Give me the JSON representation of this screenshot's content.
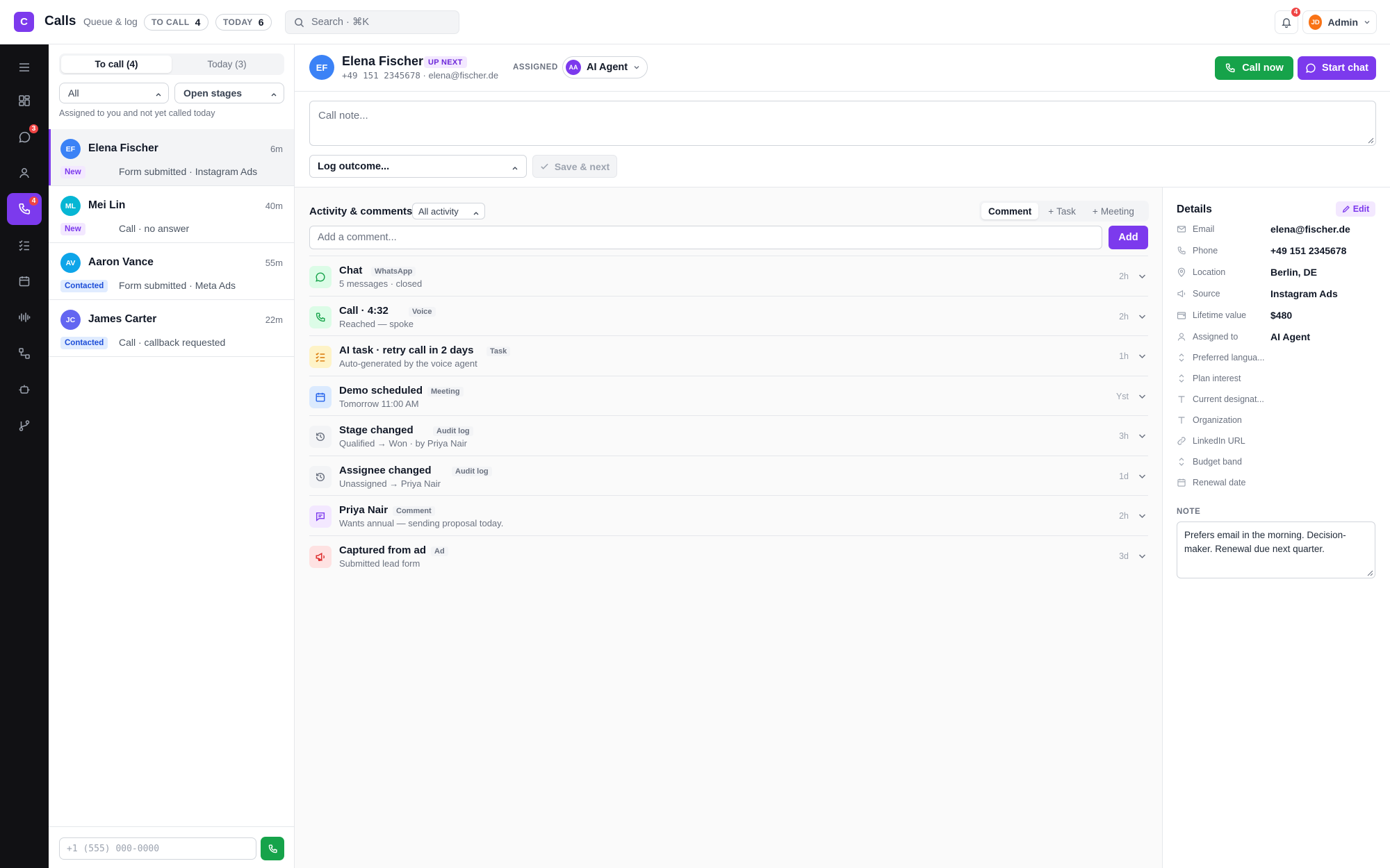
{
  "app": {
    "logo_letter": "C",
    "title": "Calls",
    "subtitle": "Queue & log"
  },
  "header": {
    "to_call_label": "TO CALL",
    "to_call_count": "4",
    "today_label": "TODAY",
    "today_count": "6",
    "search_placeholder": "Search · ⌘K",
    "notifications_count": "4",
    "user_initials": "JD",
    "user_name": "Admin"
  },
  "rail": {
    "messages_badge": "3",
    "calls_badge": "4"
  },
  "queue": {
    "tabs": [
      "To call (4)",
      "Today (3)"
    ],
    "filter_1": "All",
    "filter_2": "Open stages",
    "hint": "Assigned to you and not yet called today",
    "items": [
      {
        "initials": "EF",
        "name": "Elena Fischer",
        "time": "6m",
        "tag": "New",
        "desc": "Form submitted · Instagram Ads",
        "color": "#3b82f6"
      },
      {
        "initials": "ML",
        "name": "Mei Lin",
        "time": "40m",
        "tag": "New",
        "desc": "Call · no answer",
        "color": "#06b6d4"
      },
      {
        "initials": "AV",
        "name": "Aaron Vance",
        "time": "55m",
        "tag": "Contacted",
        "desc": "Form submitted · Meta Ads",
        "color": "#0ea5e9"
      },
      {
        "initials": "JC",
        "name": "James Carter",
        "time": "22m",
        "tag": "Contacted",
        "desc": "Call · callback requested",
        "color": "#6366f1"
      }
    ],
    "dial_placeholder": "+1 (555) 000-0000"
  },
  "contact": {
    "initials": "EF",
    "name": "Elena Fischer",
    "badge": "UP NEXT",
    "phone": "+49 151 2345678",
    "email": "elena@fischer.de",
    "assigned_label": "ASSIGNED",
    "assignee_initials": "AA",
    "assignee": "AI Agent",
    "call_button": "Call now",
    "chat_button": "Start chat"
  },
  "composer": {
    "note_placeholder": "Call note...",
    "outcome_placeholder": "Log outcome...",
    "save_next": "Save & next"
  },
  "activity": {
    "title": "Activity & comments",
    "filter": "All activity",
    "tabs": [
      "Comment",
      "Task",
      "Meeting"
    ],
    "comment_placeholder": "Add a comment...",
    "add_button": "Add",
    "items": [
      {
        "icon": "chat-icon",
        "title": "Chat",
        "kind": "WhatsApp",
        "sub": "5 messages · closed",
        "time": "2h",
        "bg": "#dcfce7",
        "fg": "#16a34a"
      },
      {
        "icon": "phone-icon",
        "title": "Call · 4:32",
        "kind": "Voice",
        "sub": "Reached — spoke",
        "time": "2h",
        "bg": "#dcfce7",
        "fg": "#16a34a"
      },
      {
        "icon": "task-icon",
        "title": "AI task · retry call in 2 days",
        "kind": "Task",
        "sub": "Auto-generated by the voice agent",
        "time": "1h",
        "bg": "#fef3c7",
        "fg": "#d97706"
      },
      {
        "icon": "calendar-icon",
        "title": "Demo scheduled",
        "kind": "Meeting",
        "sub": "Tomorrow 11:00 AM",
        "time": "Yst",
        "bg": "#dbeafe",
        "fg": "#2563eb"
      },
      {
        "icon": "history-icon",
        "title": "Stage changed",
        "kind": "Audit log",
        "sub": "Qualified → Won · by Priya Nair",
        "time": "3h",
        "bg": "#f3f4f6",
        "fg": "#6b7280"
      },
      {
        "icon": "history-icon",
        "title": "Assignee changed",
        "kind": "Audit log",
        "sub": "Unassigned → Priya Nair",
        "time": "1d",
        "bg": "#f3f4f6",
        "fg": "#6b7280"
      },
      {
        "icon": "comment-icon",
        "title": "Priya Nair",
        "kind": "Comment",
        "sub": "Wants annual — sending proposal today.",
        "time": "2h",
        "bg": "#f3e8ff",
        "fg": "#7c3aed"
      },
      {
        "icon": "megaphone-icon",
        "title": "Captured from ad",
        "kind": "Ad",
        "sub": "Submitted lead form",
        "time": "3d",
        "bg": "#fee2e2",
        "fg": "#dc2626"
      }
    ]
  },
  "details": {
    "title": "Details",
    "edit": "Edit",
    "fields": [
      {
        "icon": "mail-icon",
        "label": "Email",
        "value": "elena@fischer.de"
      },
      {
        "icon": "phone-icon",
        "label": "Phone",
        "value": "+49 151 2345678"
      },
      {
        "icon": "location-icon",
        "label": "Location",
        "value": "Berlin, DE"
      },
      {
        "icon": "megaphone-icon",
        "label": "Source",
        "value": "Instagram Ads"
      },
      {
        "icon": "wallet-icon",
        "label": "Lifetime value",
        "value": "$480"
      },
      {
        "icon": "user-icon",
        "label": "Assigned to",
        "value": "AI Agent"
      },
      {
        "icon": "select-icon",
        "label": "Preferred langua...",
        "value": ""
      },
      {
        "icon": "select-icon",
        "label": "Plan interest",
        "value": ""
      },
      {
        "icon": "text-icon",
        "label": "Current designat...",
        "value": ""
      },
      {
        "icon": "text-icon",
        "label": "Organization",
        "value": ""
      },
      {
        "icon": "link-icon",
        "label": "LinkedIn URL",
        "value": ""
      },
      {
        "icon": "select-icon",
        "label": "Budget band",
        "value": ""
      },
      {
        "icon": "calendar-icon",
        "label": "Renewal date",
        "value": ""
      }
    ],
    "note_label": "NOTE",
    "note": "Prefers email in the morning. Decision-maker. Renewal due next quarter."
  },
  "colors": {
    "accent": "#7c3aed",
    "success": "#16a34a",
    "rail": "#111114",
    "badge": "#ef4444"
  }
}
